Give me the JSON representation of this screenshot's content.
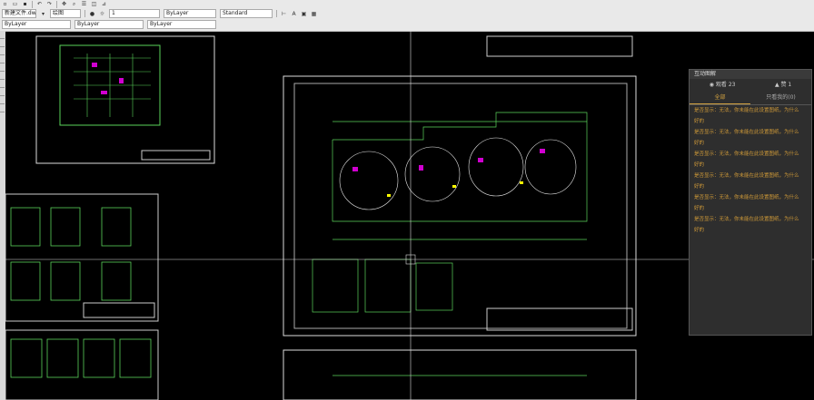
{
  "toolbar": {
    "file_name": "新建文件.dwg",
    "tab_label": "绘图",
    "layer_label": "ByLayer",
    "linetype_label": "ByLayer",
    "color_label": "ByLayer",
    "lineweight_label": "ByLayer",
    "style_label": "Standard",
    "zoom_value": "1"
  },
  "panel": {
    "title": "互动图解",
    "stats": [
      {
        "icon": "user-icon",
        "label": "观看 23"
      },
      {
        "icon": "like-icon",
        "label": "赞 1"
      }
    ],
    "tabs": [
      {
        "label": "全部"
      },
      {
        "label": "只看我的(0)"
      }
    ],
    "messages": [
      "是否显示：无法，你未能在此设置图纸，为什么",
      "好的",
      "是否显示：无法，你未能在此设置图纸，为什么",
      "好的",
      "是否显示：无法，你未能在此设置图纸，为什么",
      "好的",
      "是否显示：无法，你未能在此设置图纸，为什么",
      "好的",
      "是否显示：无法，你未能在此设置图纸，为什么",
      "好的",
      "是否显示：无法，你未能在此设置图纸，为什么",
      "好的"
    ]
  }
}
